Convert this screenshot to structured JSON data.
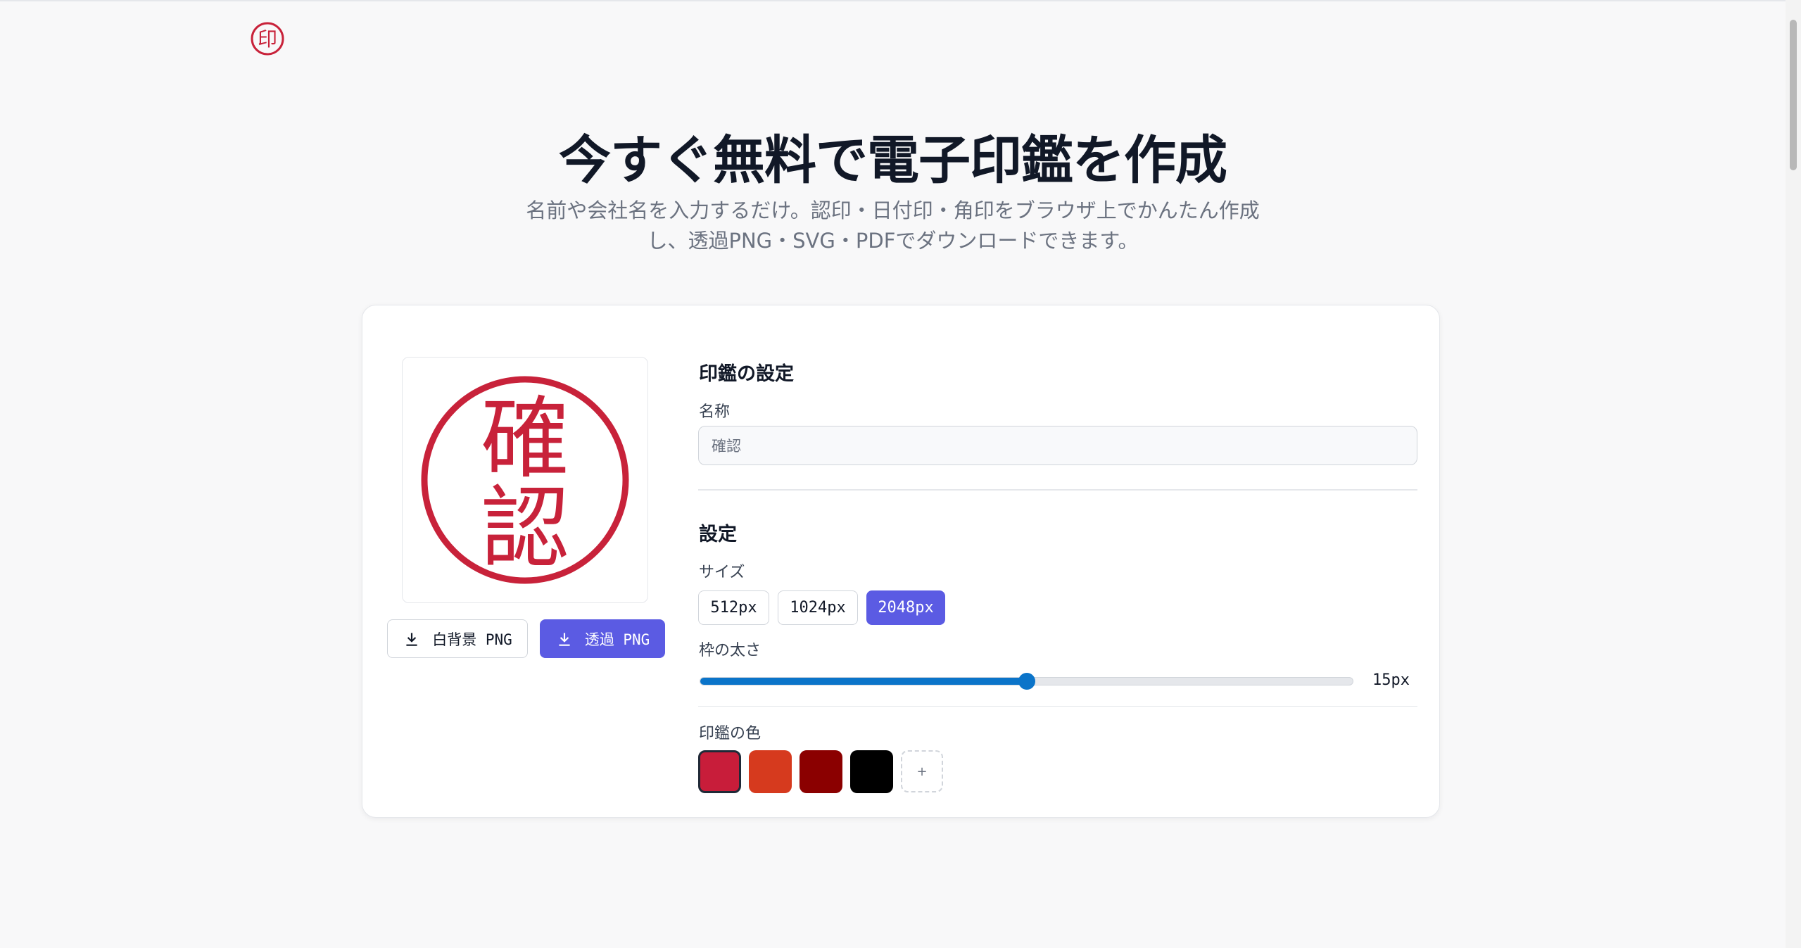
{
  "logo": {
    "glyph": "印",
    "color": "#c8223a"
  },
  "hero": {
    "title": "今すぐ無料で電子印鑑を作成",
    "subtitle": "名前や会社名を入力するだけ。認印・日付印・角印をブラウザ上でかんたん作成し、透過PNG・SVG・PDFでダウンロードできます。"
  },
  "preview": {
    "stamp_chars": [
      "確",
      "認"
    ],
    "color": "#c8223a",
    "download_white_label": "白背景 PNG",
    "download_transparent_label": "透過 PNG"
  },
  "settings": {
    "stamp_settings_title": "印鑑の設定",
    "name_label": "名称",
    "name_value": "確認",
    "general_title": "設定",
    "size_label": "サイズ",
    "sizes": [
      {
        "label": "512px",
        "active": false
      },
      {
        "label": "1024px",
        "active": false
      },
      {
        "label": "2048px",
        "active": true
      }
    ],
    "border_label": "枠の太さ",
    "border_value": "15px",
    "border_fraction": 0.5,
    "color_label": "印鑑の色",
    "colors": [
      "#c81d3a",
      "#d63a1e",
      "#8b0000",
      "#000000"
    ],
    "selected_color_index": 0,
    "add_color_label": "+"
  }
}
